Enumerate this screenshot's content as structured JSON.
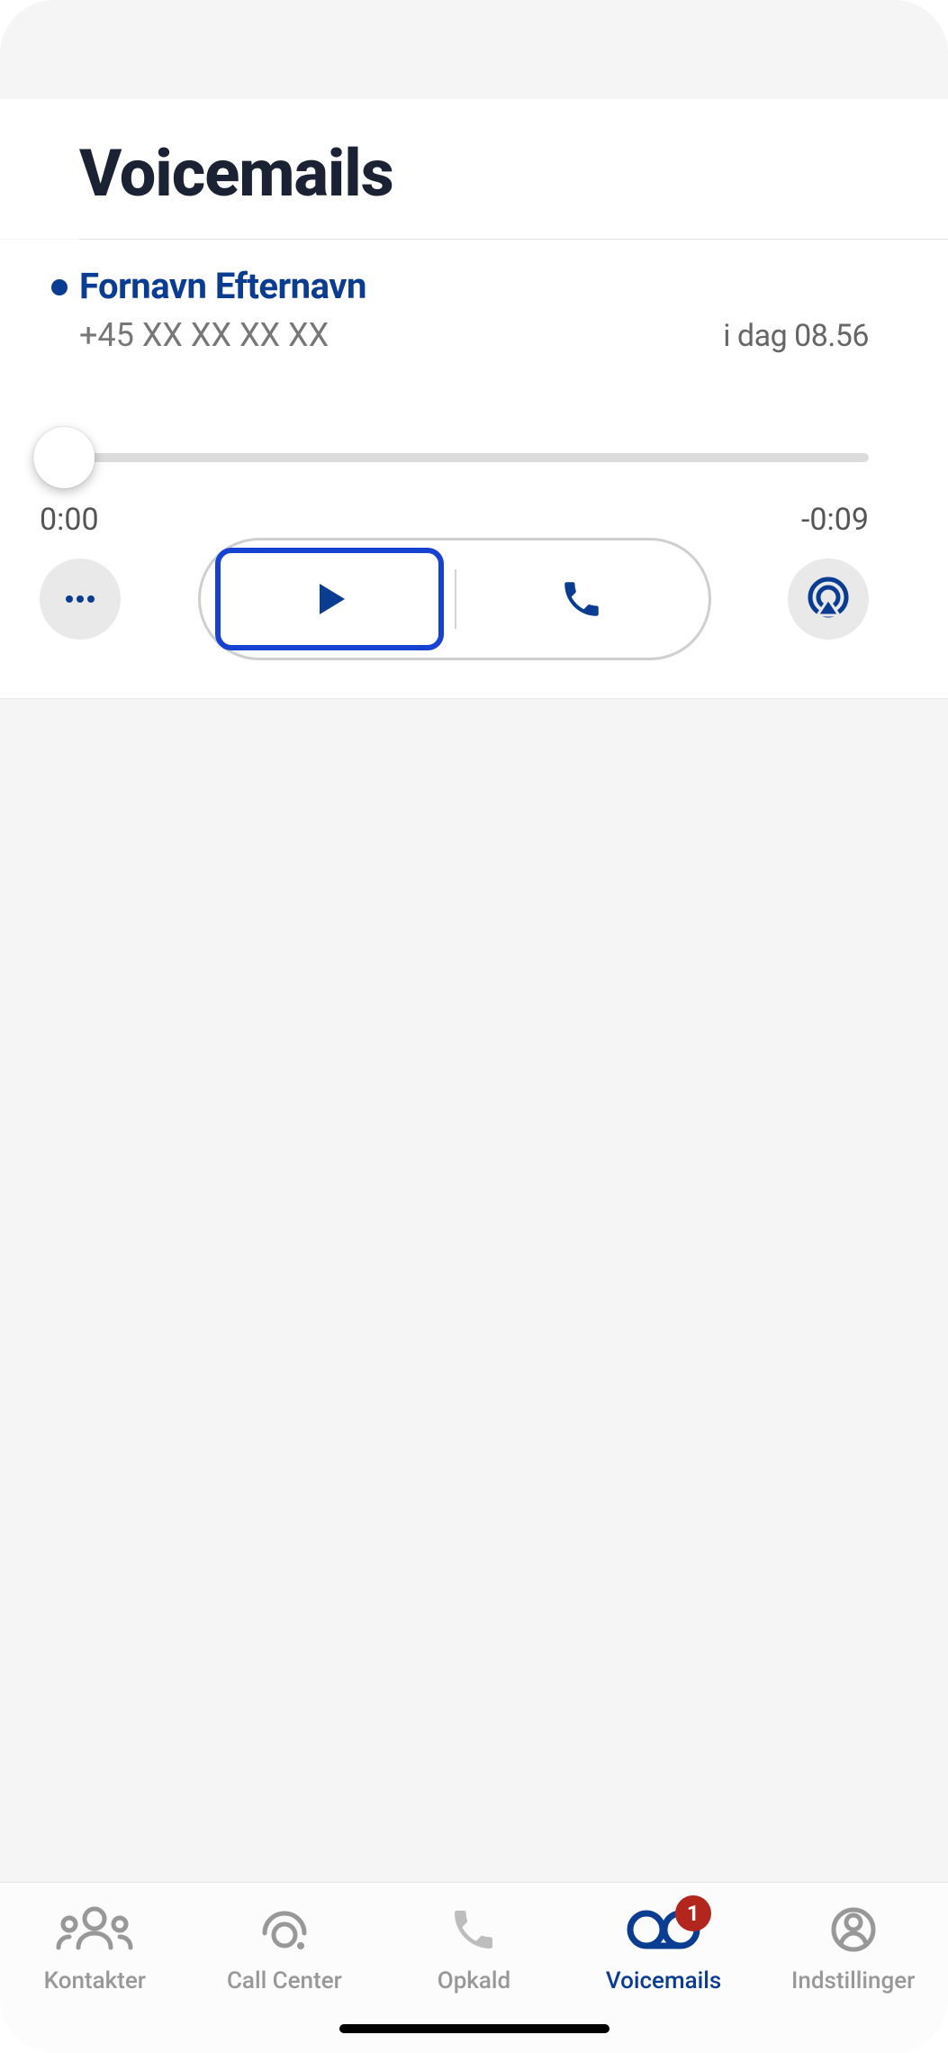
{
  "header": {
    "title": "Voicemails"
  },
  "voicemail": {
    "caller_name": "Fornavn Efternavn",
    "caller_number": "+45 XX XX XX XX",
    "timestamp": "i dag 08.56",
    "player": {
      "elapsed": "0:00",
      "remaining": "-0:09"
    }
  },
  "icons": {
    "more": "more-icon",
    "play": "play-icon",
    "call": "phone-icon",
    "airplay": "airplay-icon"
  },
  "tabs": {
    "items": [
      {
        "id": "contacts",
        "label": "Kontakter",
        "active": false
      },
      {
        "id": "callcenter",
        "label": "Call Center",
        "active": false
      },
      {
        "id": "calls",
        "label": "Opkald",
        "active": false
      },
      {
        "id": "voicemails",
        "label": "Voicemails",
        "active": true,
        "badge": "1"
      },
      {
        "id": "settings",
        "label": "Indstillinger",
        "active": false
      }
    ]
  }
}
